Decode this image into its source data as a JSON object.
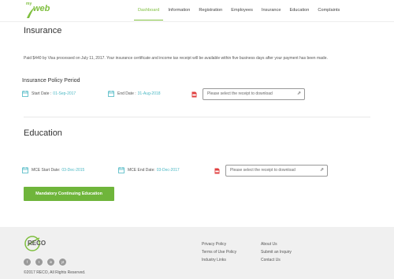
{
  "brand": {
    "my": "my",
    "web": "web",
    "accent": "#7fbf3f"
  },
  "nav": {
    "items": [
      "Dashboard",
      "Information",
      "Registration",
      "Employees",
      "Insurance",
      "Education",
      "Complaints"
    ],
    "active": "Dashboard"
  },
  "insurance": {
    "title": "Insurance",
    "paragraph": "Paid $440 by Visa processed on July 11, 2017. Your insurance certificate and income tax receipt will be available within five business days after your payment has been made.",
    "policy_heading": "Insurance Policy Period",
    "start_label": "Start Date :",
    "start_value": "01-Sep-2017",
    "end_label": "End Date :",
    "end_value": "31-Aug-2018",
    "receipt_placeholder": "Please select the receipt to download"
  },
  "education": {
    "title": "Education",
    "start_label": "MCE Start Date:",
    "start_value": "03-Dec-2015",
    "end_label": "MCE End Date:",
    "end_value": "03-Dec-2017",
    "receipt_placeholder": "Please select the receipt to download",
    "button_label": "Mandatory Continuing Education"
  },
  "footer": {
    "logo_text": "RECO",
    "socials": [
      "f",
      "t",
      "in",
      "yt"
    ],
    "copyright": "©2017 RECO, All Rights Reserved.",
    "links_col1": [
      "Privacy Policy",
      "Terms of Use Policy",
      "Industry Links"
    ],
    "links_col2": [
      "About Us",
      "Submit an Inquiry",
      "Contact Us"
    ]
  },
  "colors": {
    "green_button": "#6fb53b",
    "date_value": "#4cb8c4",
    "pdf_red": "#e04040",
    "footer_bg": "#f0f0f0"
  }
}
